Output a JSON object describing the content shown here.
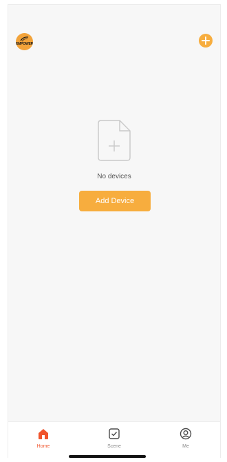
{
  "header": {
    "avatar_text": "EMPOWER",
    "add_icon": "plus-circle-icon"
  },
  "main": {
    "empty_icon": "file-plus-icon",
    "empty_text": "No devices",
    "add_device_label": "Add Device"
  },
  "tabbar": {
    "tabs": [
      {
        "label": "Home",
        "icon": "home-icon",
        "active": true
      },
      {
        "label": "Scene",
        "icon": "checkbox-icon",
        "active": false
      },
      {
        "label": "Me",
        "icon": "user-circle-icon",
        "active": false
      }
    ]
  },
  "colors": {
    "accent": "#f7ad3e",
    "active_tab": "#f0542c",
    "background": "#f7f7f7"
  }
}
